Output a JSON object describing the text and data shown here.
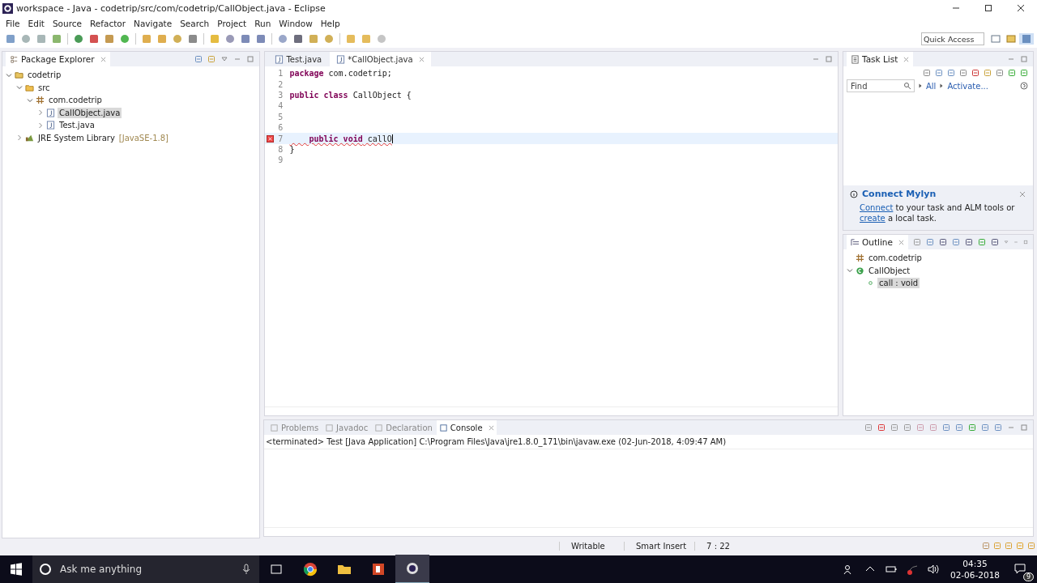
{
  "window": {
    "title": "workspace - Java - codetrip/src/com/codetrip/CallObject.java - Eclipse"
  },
  "menu": [
    "File",
    "Edit",
    "Source",
    "Refactor",
    "Navigate",
    "Search",
    "Project",
    "Run",
    "Window",
    "Help"
  ],
  "quick_access": {
    "placeholder": "Quick Access"
  },
  "package_explorer": {
    "title": "Package Explorer",
    "tree": [
      {
        "label": "codetrip",
        "kind": "project",
        "expanded": true,
        "selected": false,
        "children": [
          {
            "label": "src",
            "kind": "folder",
            "expanded": true,
            "selected": false,
            "children": [
              {
                "label": "com.codetrip",
                "kind": "package",
                "expanded": true,
                "selected": false,
                "children": [
                  {
                    "label": "CallObject.java",
                    "kind": "file",
                    "expanded": false,
                    "selected": true
                  },
                  {
                    "label": "Test.java",
                    "kind": "file",
                    "expanded": false,
                    "selected": false
                  }
                ]
              }
            ]
          },
          {
            "label": "JRE System Library",
            "decoration": "[JavaSE-1.8]",
            "kind": "library",
            "expanded": false,
            "selected": false
          }
        ]
      }
    ]
  },
  "editor": {
    "tabs": [
      {
        "label": "Test.java",
        "selected": false
      },
      {
        "label": "*CallObject.java",
        "selected": true
      }
    ],
    "lines": [
      {
        "number": "1",
        "code": "**package** com.codetrip;",
        "current": false,
        "error": false
      },
      {
        "number": "2",
        "current": false,
        "error": false
      },
      {
        "number": "3",
        "code": "**public class** CallObject {",
        "current": false,
        "error": false
      },
      {
        "number": "4",
        "current": false,
        "error": false
      },
      {
        "number": "5",
        "current": false,
        "error": false
      },
      {
        "number": "6",
        "current": false,
        "error": false
      },
      {
        "number": "7",
        "code": "    **public void** callO",
        "current": true,
        "error": true
      },
      {
        "number": "8",
        "code": "}",
        "current": false,
        "error": false
      },
      {
        "number": "9",
        "current": false,
        "error": false
      }
    ]
  },
  "task_list": {
    "title": "Task List",
    "find": {
      "placeholder": "Find"
    },
    "links": [
      "All",
      "Activate..."
    ]
  },
  "mylyn": {
    "title": "Connect Mylyn",
    "link1": "Connect",
    "text1": " to your task and ALM tools or ",
    "link2": "create",
    "text2": " a local task."
  },
  "outline": {
    "title": "Outline",
    "tree": [
      {
        "label": "com.codetrip",
        "kind": "package",
        "selected": false
      },
      {
        "label": "CallObject",
        "kind": "class",
        "expanded": true,
        "selected": false,
        "children": [
          {
            "label": "call : void",
            "kind": "method",
            "selected": true
          }
        ]
      }
    ]
  },
  "bottom_tabs": [
    {
      "label": "Problems",
      "selected": false
    },
    {
      "label": "Javadoc",
      "selected": false
    },
    {
      "label": "Declaration",
      "selected": false
    },
    {
      "label": "Console",
      "selected": true
    }
  ],
  "console": {
    "status": "<terminated> Test [Java Application] C:\\Program Files\\Java\\jre1.8.0_171\\bin\\javaw.exe (02-Jun-2018, 4:09:47 AM)"
  },
  "status_bar": [
    "Writable",
    "Smart Insert",
    "7 : 22"
  ],
  "taskbar": {
    "search": {
      "placeholder": "Ask me anything"
    },
    "time": "04:35",
    "date": "02-06-2018",
    "notifications": "9"
  }
}
